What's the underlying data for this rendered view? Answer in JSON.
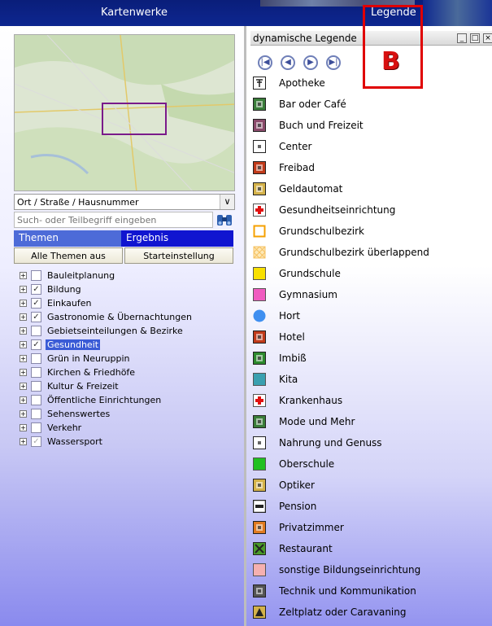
{
  "topbar": {
    "left_title": "Kartenwerke",
    "right_title": "Legende"
  },
  "search": {
    "location_select_value": "Ort / Straße / Hausnummer",
    "placeholder": "Such- oder Teilbegriff eingeben"
  },
  "tabs": {
    "themes": "Themen",
    "result": "Ergebnis"
  },
  "buttons": {
    "all_off": "Alle Themen aus",
    "reset": "Starteinstellung"
  },
  "theme_tree": [
    {
      "label": "Bauleitplanung",
      "checked": false,
      "selected": false
    },
    {
      "label": "Bildung",
      "checked": true,
      "selected": false
    },
    {
      "label": "Einkaufen",
      "checked": true,
      "selected": false
    },
    {
      "label": "Gastronomie & Übernachtungen",
      "checked": true,
      "selected": false
    },
    {
      "label": "Gebietseinteilungen & Bezirke",
      "checked": false,
      "selected": false
    },
    {
      "label": "Gesundheit",
      "checked": true,
      "selected": true
    },
    {
      "label": "Grün in Neuruppin",
      "checked": false,
      "selected": false
    },
    {
      "label": "Kirchen & Friedhöfe",
      "checked": false,
      "selected": false
    },
    {
      "label": "Kultur & Freizeit",
      "checked": false,
      "selected": false
    },
    {
      "label": "Öffentliche Einrichtungen",
      "checked": false,
      "selected": false
    },
    {
      "label": "Sehenswertes",
      "checked": false,
      "selected": false
    },
    {
      "label": "Verkehr",
      "checked": false,
      "selected": false
    },
    {
      "label": "Wassersport",
      "checked": true,
      "selected": false,
      "grayed": true
    }
  ],
  "legend": {
    "title": "dynamische Legende",
    "annotation": "B",
    "items": [
      {
        "label": "Apotheke",
        "icon": "pharmacy-icon",
        "color": "#ffffff"
      },
      {
        "label": "Bar oder Café",
        "icon": "bar-cafe-icon",
        "color": "#3a7d3a"
      },
      {
        "label": "Buch und Freizeit",
        "icon": "book-icon",
        "color": "#8a4a6a"
      },
      {
        "label": "Center",
        "icon": "center-icon",
        "color": "#ffffff"
      },
      {
        "label": "Freibad",
        "icon": "outdoor-pool-icon",
        "color": "#c03a1a"
      },
      {
        "label": "Geldautomat",
        "icon": "atm-icon",
        "color": "#d4b24a"
      },
      {
        "label": "Gesundheitseinrichtung",
        "icon": "health-facility-icon",
        "color": "#e01010"
      },
      {
        "label": "Grundschulbezirk",
        "icon": "school-district-icon",
        "color": "#f5a000"
      },
      {
        "label": "Grundschulbezirk überlappend",
        "icon": "school-district-overlap-icon",
        "color": "#f5c060"
      },
      {
        "label": "Grundschule",
        "icon": "primary-school-icon",
        "color": "#f8e000"
      },
      {
        "label": "Gymnasium",
        "icon": "gymnasium-icon",
        "color": "#f05bc0"
      },
      {
        "label": "Hort",
        "icon": "after-school-care-icon",
        "color": "#3f8ff0"
      },
      {
        "label": "Hotel",
        "icon": "hotel-icon",
        "color": "#c03a1a"
      },
      {
        "label": "Imbiß",
        "icon": "snack-bar-icon",
        "color": "#2d8a2d"
      },
      {
        "label": "Kita",
        "icon": "kindergarten-icon",
        "color": "#3aa0b0"
      },
      {
        "label": "Krankenhaus",
        "icon": "hospital-icon",
        "color": "#e01010"
      },
      {
        "label": "Mode und Mehr",
        "icon": "fashion-icon",
        "color": "#3a7d3a"
      },
      {
        "label": "Nahrung und Genuss",
        "icon": "food-icon",
        "color": "#ffffff"
      },
      {
        "label": "Oberschule",
        "icon": "secondary-school-icon",
        "color": "#20c020"
      },
      {
        "label": "Optiker",
        "icon": "optician-icon",
        "color": "#d4b24a"
      },
      {
        "label": "Pension",
        "icon": "guesthouse-icon",
        "color": "#ffffff"
      },
      {
        "label": "Privatzimmer",
        "icon": "private-room-icon",
        "color": "#e07a20"
      },
      {
        "label": "Restaurant",
        "icon": "restaurant-icon",
        "color": "#4a9a2a"
      },
      {
        "label": "sonstige Bildungseinrichtung",
        "icon": "other-education-icon",
        "color": "#f5b0b0"
      },
      {
        "label": "Technik und Kommunikation",
        "icon": "tech-icon",
        "color": "#555555"
      },
      {
        "label": "Zeltplatz oder Caravaning",
        "icon": "camping-icon",
        "color": "#d4b24a"
      }
    ]
  }
}
